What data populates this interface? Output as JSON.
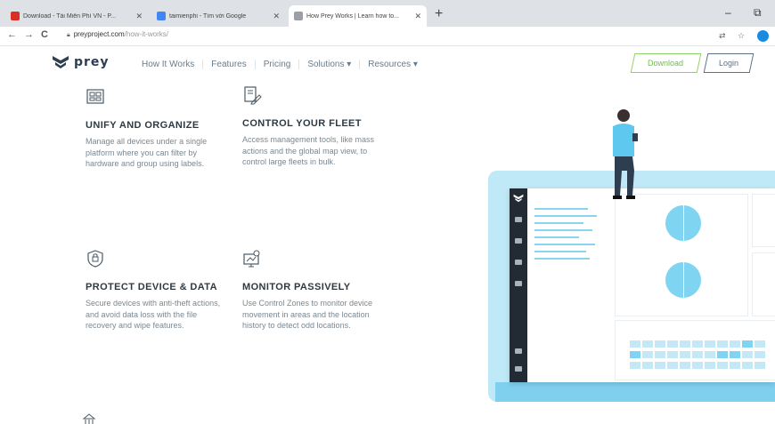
{
  "browser": {
    "tabs": [
      {
        "title": "Download - Tải Miễn Phí VN - P...",
        "favicon": "#d93025",
        "active": false
      },
      {
        "title": "taimienphi - Tìm với Google",
        "favicon": "#4285f4",
        "active": false
      },
      {
        "title": "How Prey Works | Learn how to...",
        "favicon": "#9aa0a6",
        "active": true
      }
    ],
    "new_tab": "+",
    "window_controls": {
      "minimize": "–",
      "maximize": "⧉"
    },
    "url": {
      "host": "preyproject.com",
      "path": "/how-it-works/"
    },
    "nav": {
      "back": "←",
      "forward": "→",
      "reload": "C"
    }
  },
  "site": {
    "logo": "prey",
    "nav": [
      "How It Works",
      "Features",
      "Pricing",
      "Solutions ▾",
      "Resources ▾"
    ],
    "download_label": "Download",
    "login_label": "Login",
    "features": [
      {
        "icon": "device-grid-icon",
        "title": "UNIFY AND ORGANIZE",
        "text": "Manage all devices under a single platform where you can filter by hardware and group using labels."
      },
      {
        "icon": "document-pen-icon",
        "title": "CONTROL YOUR FLEET",
        "text": "Access management tools, like mass actions and the global map view, to control large fleets in bulk."
      },
      {
        "icon": "shield-lock-icon",
        "title": "PROTECT DEVICE & DATA",
        "text": "Secure devices with anti-theft actions, and avoid data loss with the file recovery and wipe features."
      },
      {
        "icon": "monitor-location-icon",
        "title": "MONITOR PASSIVELY",
        "text": "Use Control Zones to monitor device movement in areas and the location history to detect odd locations."
      }
    ]
  },
  "colors": {
    "accent_green": "#6cbf45",
    "dashboard_blue": "#7fd4f2",
    "heading": "#2d3a44"
  }
}
